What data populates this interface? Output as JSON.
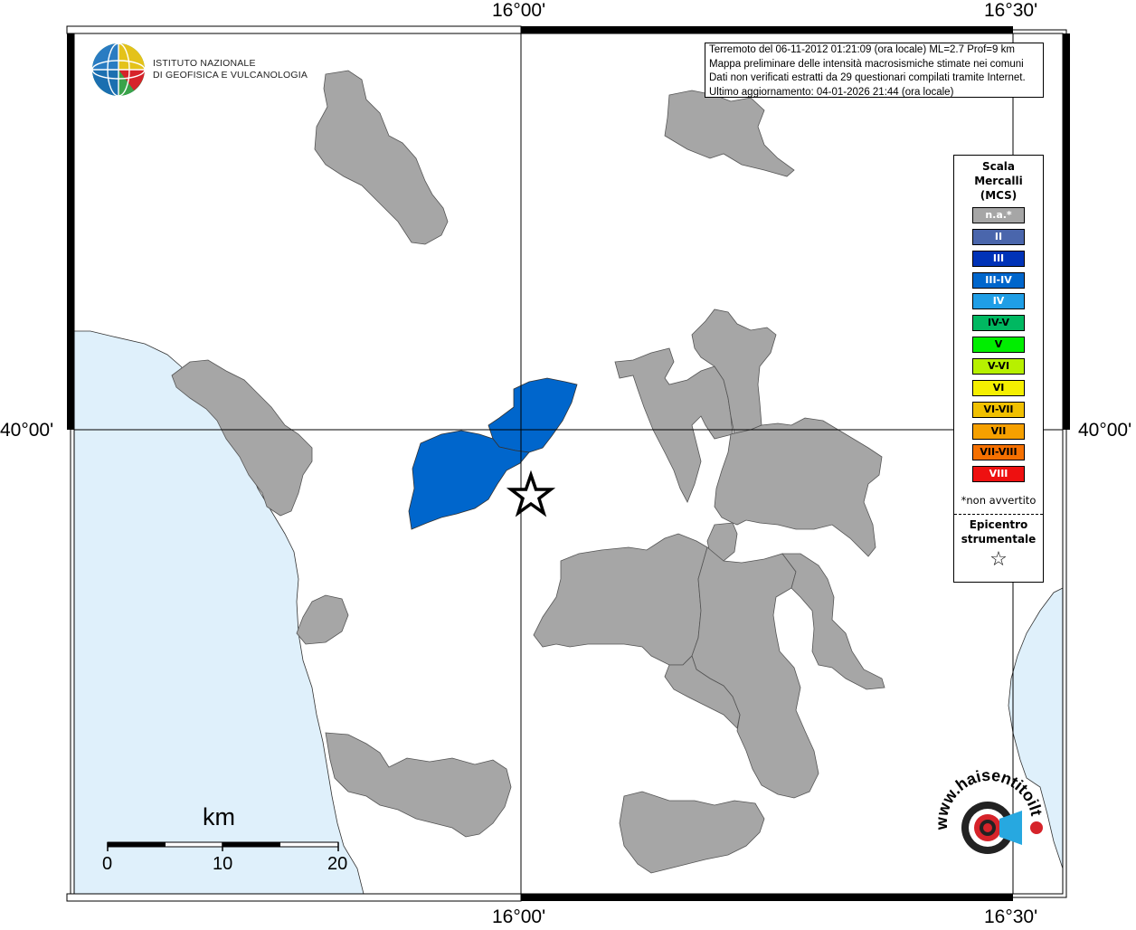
{
  "axes": {
    "lon_labels": [
      "16°00'",
      "16°30'"
    ],
    "lat_labels": [
      "40°00'"
    ]
  },
  "info": {
    "line1": "Terremoto del 06-11-2012 01:21:09 (ora locale) ML=2.7 Prof=9 km",
    "line2": "Mappa preliminare delle intensità macrosismiche stimate nei comuni",
    "line3": "Dati non verificati estratti da 29 questionari compilati tramite Internet.",
    "line4": "Ultimo aggiornamento: 04-01-2026 21:44 (ora locale)"
  },
  "logo": {
    "line1": "ISTITUTO NAZIONALE",
    "line2": "DI GEOFISICA E VULCANOLOGIA"
  },
  "legend": {
    "title1": "Scala",
    "title2": "Mercalli",
    "title3": "(MCS)",
    "items": [
      {
        "label": "n.a.*",
        "color": "#a6a6a6"
      },
      {
        "label": "II",
        "color": "#4a66ac"
      },
      {
        "label": "III",
        "color": "#0033b8"
      },
      {
        "label": "III-IV",
        "color": "#0066cc"
      },
      {
        "label": "IV",
        "color": "#1f9ee6"
      },
      {
        "label": "IV-V",
        "color": "#00b861"
      },
      {
        "label": "V",
        "color": "#00ee00"
      },
      {
        "label": "V-VI",
        "color": "#b7f000"
      },
      {
        "label": "VI",
        "color": "#f5ef00"
      },
      {
        "label": "VI-VII",
        "color": "#f0c000"
      },
      {
        "label": "VII",
        "color": "#f5a000"
      },
      {
        "label": "VII-VIII",
        "color": "#f57000"
      },
      {
        "label": "VIII",
        "color": "#ee1010"
      }
    ],
    "note": "*non avvertito",
    "epicentre1": "Epicentro",
    "epicentre2": "strumentale",
    "star": "☆"
  },
  "scalebar": {
    "unit": "km",
    "ticks": [
      "0",
      "10",
      "20"
    ]
  },
  "colors": {
    "sea": "#dff0fb",
    "municipality_na": "#a6a6a6",
    "municipality_III_IV": "#0066cc"
  },
  "watermark": "www.haisentitoilterremoto.it"
}
